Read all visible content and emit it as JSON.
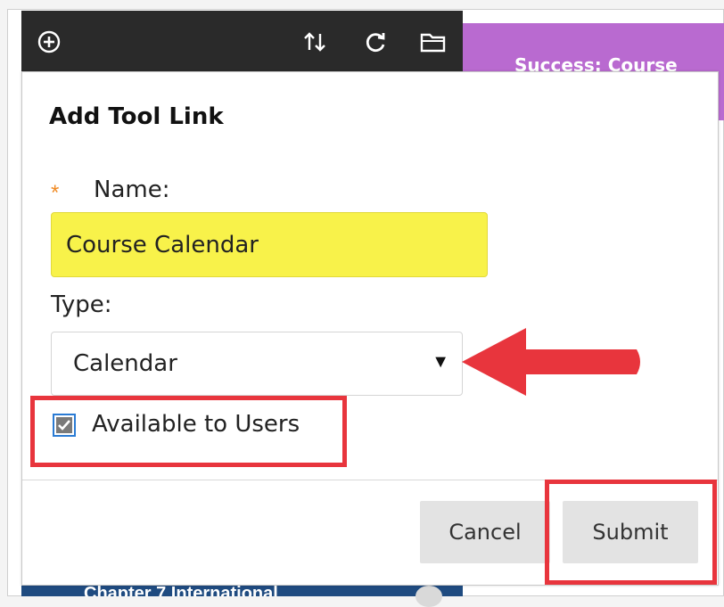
{
  "toolbar": {
    "icons": [
      "add-circle-icon",
      "reorder-arrows-icon",
      "refresh-icon",
      "folder-icon"
    ]
  },
  "banner": {
    "text": "Success: Course",
    "color": "#b96ad0"
  },
  "dialog": {
    "title": "Add Tool Link",
    "required_marker": "*",
    "name_label": "Name:",
    "name_value": "Course Calendar",
    "type_label": "Type:",
    "type_value": "Calendar",
    "available_label": "Available to Users",
    "available_checked": true,
    "cancel_label": "Cancel",
    "submit_label": "Submit"
  },
  "background_menu": {
    "partial_item": "Chapter 7 International"
  },
  "annotations": {
    "color": "#e8353d",
    "arrow_target": "type-select"
  }
}
